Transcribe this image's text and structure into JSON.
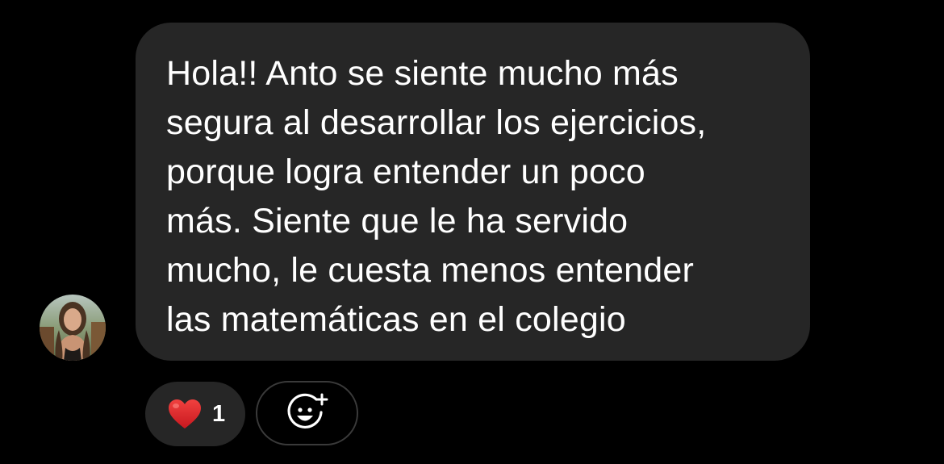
{
  "message": {
    "lines": [
      "Hola!! Anto se siente mucho más",
      "segura al desarrollar los ejercicios,",
      "porque logra entender un poco",
      "más. Siente que le ha servido",
      "mucho, le cuesta menos entender",
      "las matemáticas en el colegio"
    ]
  },
  "reaction": {
    "emoji_icon": "red-heart-icon",
    "count": "1",
    "heart_color": "#e0242f"
  },
  "add_reaction": {
    "icon": "smiley-plus-icon"
  },
  "colors": {
    "background": "#000000",
    "bubble": "#262626",
    "text": "#ffffff",
    "pill_outline": "#3a3a3a"
  }
}
